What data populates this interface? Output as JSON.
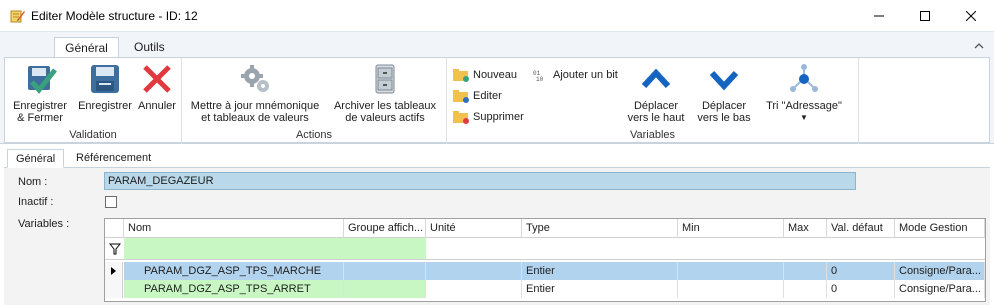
{
  "window": {
    "title": "Editer Modèle structure - ID: 12",
    "app_icon": "pencil-notepad-icon"
  },
  "ribbon": {
    "tabs": [
      {
        "label": "Général",
        "active": true
      },
      {
        "label": "Outils",
        "active": false
      }
    ],
    "groups": {
      "validation": {
        "label": "Validation",
        "save_close": "Enregistrer\n& Fermer",
        "save_close_lines": [
          "Enregistrer",
          "& Fermer"
        ],
        "save": "Enregistrer",
        "cancel": "Annuler"
      },
      "actions": {
        "label": "Actions",
        "update_lines": [
          "Mettre à jour mnémonique",
          "et tableaux de valeurs"
        ],
        "archive_lines": [
          "Archiver les tableaux",
          "de valeurs actifs"
        ]
      },
      "variables": {
        "label": "Variables",
        "new": "Nouveau",
        "edit": "Editer",
        "delete": "Supprimer",
        "add_bit": "Ajouter un bit",
        "move_up_lines": [
          "Déplacer",
          "vers le haut"
        ],
        "move_down_lines": [
          "Déplacer",
          "vers le bas"
        ],
        "sort": "Tri \"Adressage\""
      }
    },
    "colors": {
      "accent_blue": "#1565c0",
      "save_blue": "#3d6e9e",
      "cancel_red": "#e0393e",
      "check_green": "#3aa17e"
    }
  },
  "content_tabs": [
    {
      "label": "Général",
      "active": true
    },
    {
      "label": "Référencement",
      "active": false
    }
  ],
  "form": {
    "nom_label": "Nom :",
    "nom_value": "PARAM_DEGAZEUR",
    "inactif_label": "Inactif :",
    "inactif_checked": false,
    "variables_label": "Variables :"
  },
  "grid": {
    "columns": [
      "Nom",
      "Groupe affich...",
      "Unité",
      "Type",
      "Min",
      "Max",
      "Val. défaut",
      "Mode Gestion"
    ],
    "rows": [
      {
        "nom": "PARAM_DGZ_ASP_TPS_MARCHE",
        "groupe": "",
        "unite": "",
        "type": "Entier",
        "min": "",
        "max": "",
        "val_defaut": "0",
        "mode": "Consigne/Para...",
        "selected": true
      },
      {
        "nom": "PARAM_DGZ_ASP_TPS_ARRET",
        "groupe": "",
        "unite": "",
        "type": "Entier",
        "min": "",
        "max": "",
        "val_defaut": "0",
        "mode": "Consigne/Para...",
        "selected": false
      }
    ],
    "colors": {
      "filter_green": "#c9f7c4",
      "selected_blue": "#b2d3ee"
    }
  }
}
